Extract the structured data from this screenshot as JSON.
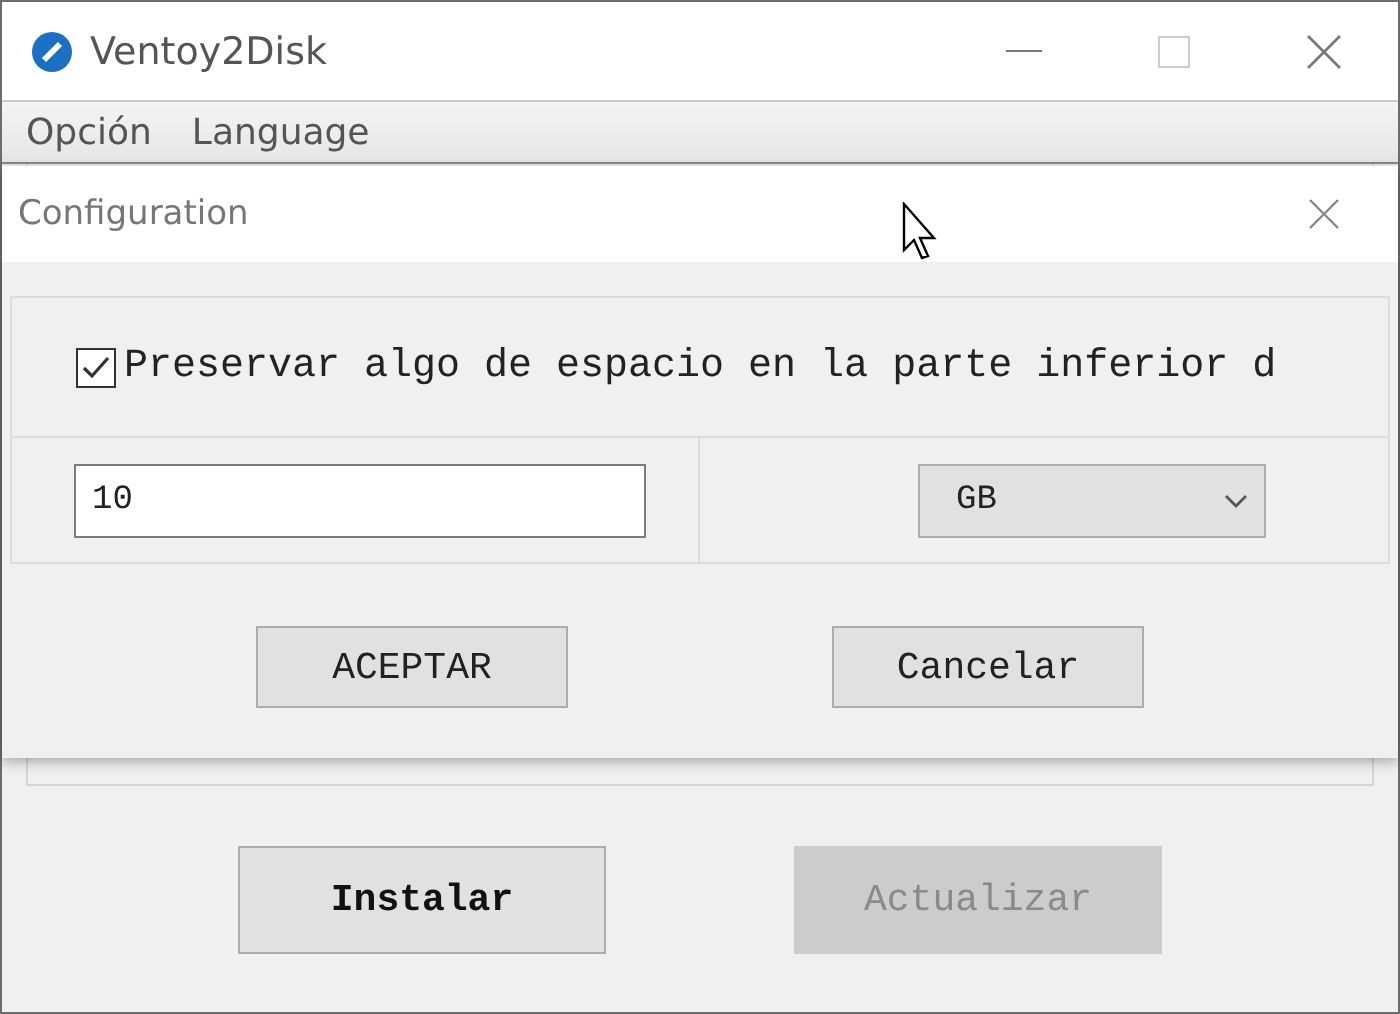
{
  "window": {
    "title": "Ventoy2Disk"
  },
  "menu": [
    {
      "label": "Opción"
    },
    {
      "label": "Language"
    }
  ],
  "main_buttons": [
    {
      "label": "Instalar",
      "disabled": false
    },
    {
      "label": "Actualizar",
      "disabled": true
    }
  ],
  "dialog": {
    "title": "Configuration",
    "checkbox": {
      "label": "Preservar algo de espacio en la parte inferior d",
      "checked": true
    },
    "size_field": {
      "value": "10"
    },
    "unit_select": {
      "value": "GB"
    },
    "buttons": [
      {
        "label": "ACEPTAR"
      },
      {
        "label": "Cancelar"
      }
    ]
  }
}
